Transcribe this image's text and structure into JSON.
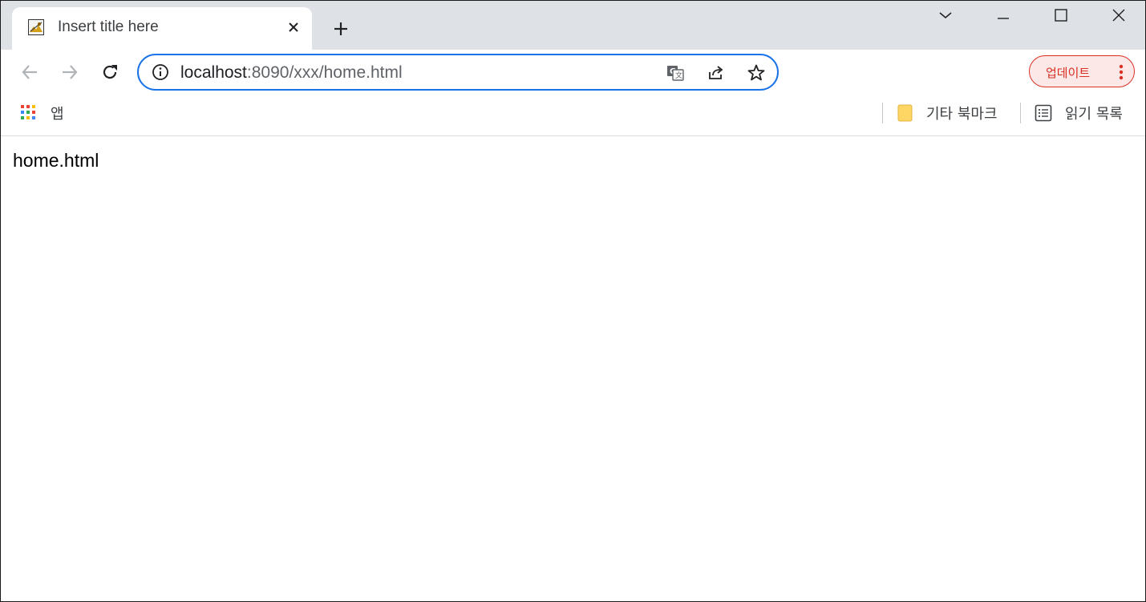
{
  "tab": {
    "title": "Insert title here",
    "favicon": "broken-image-icon"
  },
  "window_controls": {
    "tab_search": "chevron-down-icon",
    "minimize": "minimize-icon",
    "maximize": "maximize-icon",
    "close": "close-icon"
  },
  "toolbar": {
    "back": "back-arrow-icon",
    "forward": "forward-arrow-icon",
    "reload": "reload-icon",
    "url_host": "localhost",
    "url_path": ":8090/xxx/home.html",
    "translate": "translate-icon",
    "share": "share-icon",
    "bookmark": "star-icon",
    "update_label": "업데이트",
    "update_color": "#d93025"
  },
  "bookmarks": {
    "apps_label": "앱",
    "other_bookmarks_label": "기타 북마크",
    "reading_list_label": "읽기 목록"
  },
  "page": {
    "body_text": "home.html"
  },
  "colors": {
    "tabstrip_bg": "#dee1e6",
    "omnibox_focus": "#1a73e8",
    "folder_yellow": "#fdd663"
  }
}
